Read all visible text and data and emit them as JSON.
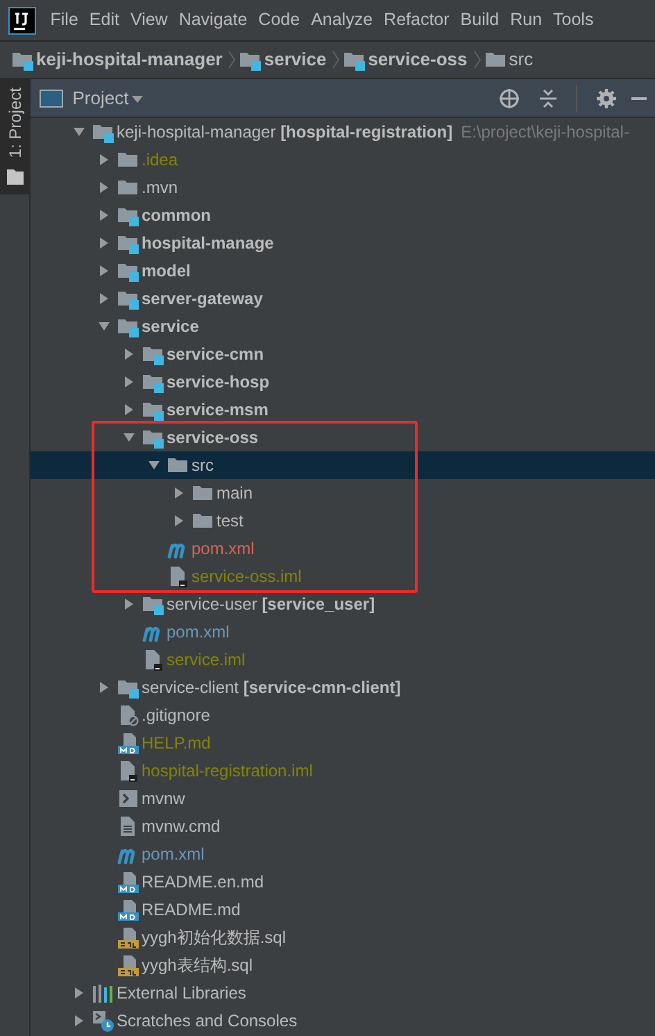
{
  "menu_bar": {
    "items": [
      "File",
      "Edit",
      "View",
      "Navigate",
      "Code",
      "Analyze",
      "Refactor",
      "Build",
      "Run",
      "Tools"
    ]
  },
  "breadcrumb": [
    {
      "label": "keji-hospital-manager",
      "kind": "module"
    },
    {
      "label": "service",
      "kind": "module"
    },
    {
      "label": "service-oss",
      "kind": "module"
    },
    {
      "label": "src",
      "kind": "folder"
    }
  ],
  "side_tab": {
    "label": "1: Project",
    "selected": true
  },
  "project_panel": {
    "title": "Project",
    "tree": [
      {
        "name": "keji-hospital-manager **[hospital-registration]**",
        "path": "E:\\project\\keji-hospital-",
        "kind": "module",
        "bold": false,
        "expanded": true,
        "selected": false,
        "children": [
          {
            "name": ".idea",
            "kind": "folder",
            "color": "#848504",
            "bold": false,
            "expanded": false,
            "selected": false
          },
          {
            "name": ".mvn",
            "kind": "folder",
            "bold": false,
            "expanded": false,
            "selected": false
          },
          {
            "name": "common",
            "kind": "module",
            "bold": true,
            "expanded": false,
            "selected": false
          },
          {
            "name": "hospital-manage",
            "kind": "module",
            "bold": true,
            "expanded": false,
            "selected": false
          },
          {
            "name": "model",
            "kind": "module",
            "bold": true,
            "expanded": false,
            "selected": false
          },
          {
            "name": "server-gateway",
            "kind": "module",
            "bold": true,
            "expanded": false,
            "selected": false
          },
          {
            "name": "service",
            "kind": "module",
            "bold": true,
            "expanded": true,
            "selected": false,
            "children": [
              {
                "name": "service-cmn",
                "kind": "module",
                "bold": true,
                "expanded": false,
                "selected": false
              },
              {
                "name": "service-hosp",
                "kind": "module",
                "bold": true,
                "expanded": false,
                "selected": false
              },
              {
                "name": "service-msm",
                "kind": "module",
                "bold": true,
                "expanded": false,
                "selected": false
              },
              {
                "name": "service-oss",
                "kind": "module",
                "bold": true,
                "expanded": true,
                "selected": false,
                "boxed": true,
                "children": [
                  {
                    "name": "src",
                    "kind": "folder",
                    "bold": false,
                    "expanded": true,
                    "selected": true,
                    "children": [
                      {
                        "name": "main",
                        "kind": "folder",
                        "bold": false,
                        "expanded": false,
                        "selected": false
                      },
                      {
                        "name": "test",
                        "kind": "folder",
                        "bold": false,
                        "expanded": false,
                        "selected": false
                      }
                    ]
                  },
                  {
                    "name": "pom.xml",
                    "kind": "maven",
                    "color": "#d1675a",
                    "bold": false,
                    "selected": false
                  },
                  {
                    "name": "service-oss.iml",
                    "kind": "iml",
                    "color": "#848504",
                    "bold": false,
                    "selected": false
                  }
                ]
              },
              {
                "name": "service-user **[service_user]**",
                "kind": "module",
                "bold": false,
                "expanded": false,
                "selected": false
              },
              {
                "name": "pom.xml",
                "kind": "maven",
                "color": "#6897bb",
                "bold": false,
                "selected": false
              },
              {
                "name": "service.iml",
                "kind": "iml",
                "color": "#848504",
                "bold": false,
                "selected": false
              }
            ]
          },
          {
            "name": "service-client **[service-cmn-client]**",
            "kind": "module",
            "bold": false,
            "expanded": false,
            "selected": false
          },
          {
            "name": ".gitignore",
            "kind": "gitignore",
            "bold": false,
            "selected": false
          },
          {
            "name": "HELP.md",
            "kind": "markdown",
            "color": "#848504",
            "bold": false,
            "selected": false
          },
          {
            "name": "hospital-registration.iml",
            "kind": "iml",
            "color": "#848504",
            "bold": false,
            "selected": false
          },
          {
            "name": "mvnw",
            "kind": "executable",
            "bold": false,
            "selected": false
          },
          {
            "name": "mvnw.cmd",
            "kind": "text",
            "bold": false,
            "selected": false
          },
          {
            "name": "pom.xml",
            "kind": "maven",
            "color": "#6897bb",
            "bold": false,
            "selected": false
          },
          {
            "name": "README.en.md",
            "kind": "markdown",
            "bold": false,
            "selected": false
          },
          {
            "name": "README.md",
            "kind": "markdown",
            "bold": false,
            "selected": false
          },
          {
            "name": "yygh初始化数据.sql",
            "kind": "sql",
            "bold": false,
            "selected": false
          },
          {
            "name": "yygh表结构.sql",
            "kind": "sql",
            "bold": false,
            "selected": false
          }
        ]
      },
      {
        "name": "External Libraries",
        "kind": "libraries",
        "bold": false,
        "expanded": false,
        "selected": false
      },
      {
        "name": "Scratches and Consoles",
        "kind": "scratches",
        "bold": false,
        "expanded": false,
        "selected": false
      }
    ]
  }
}
